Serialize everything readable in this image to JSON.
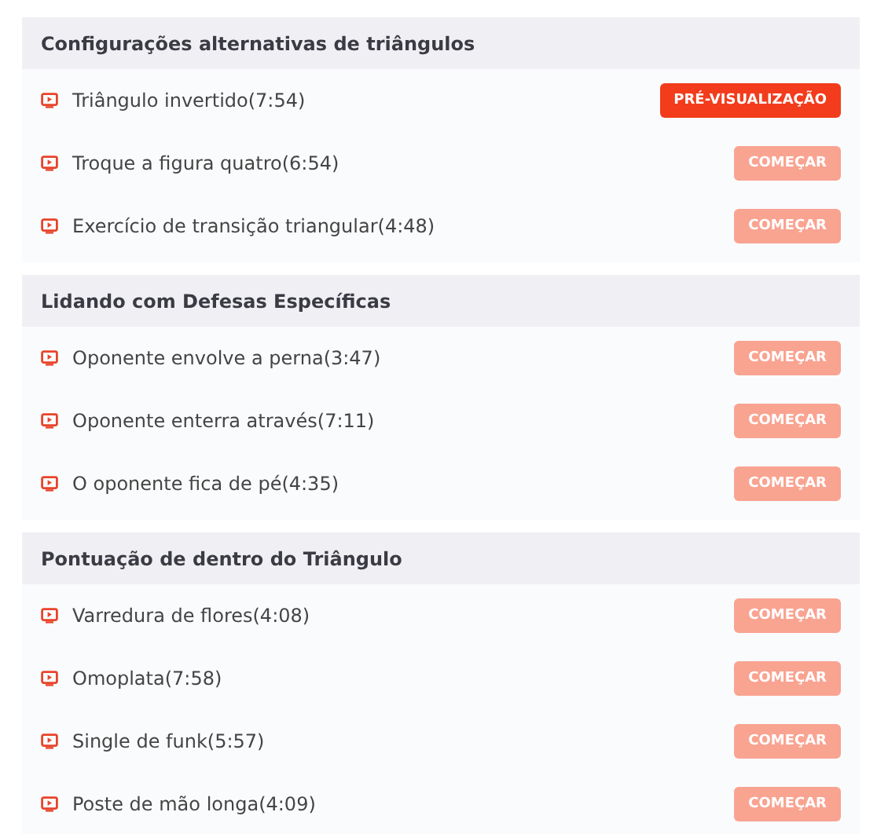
{
  "sections": [
    {
      "title": "Configurações alternativas de triângulos",
      "lessons": [
        {
          "title": "Triângulo invertido(7:54)",
          "button": {
            "label": "PRÉ-VISUALIZAÇÃO",
            "kind": "preview"
          }
        },
        {
          "title": "Troque a figura quatro(6:54)",
          "button": {
            "label": "COMEÇAR",
            "kind": "start"
          }
        },
        {
          "title": "Exercício de transição triangular(4:48)",
          "button": {
            "label": "COMEÇAR",
            "kind": "start"
          }
        }
      ]
    },
    {
      "title": "Lidando com Defesas Específicas",
      "lessons": [
        {
          "title": "Oponente envolve a perna(3:47)",
          "button": {
            "label": "COMEÇAR",
            "kind": "start"
          }
        },
        {
          "title": "Oponente enterra através(7:11)",
          "button": {
            "label": "COMEÇAR",
            "kind": "start"
          }
        },
        {
          "title": "O oponente fica de pé(4:35)",
          "button": {
            "label": "COMEÇAR",
            "kind": "start"
          }
        }
      ]
    },
    {
      "title": "Pontuação de dentro do Triângulo",
      "lessons": [
        {
          "title": "Varredura de flores(4:08)",
          "button": {
            "label": "COMEÇAR",
            "kind": "start"
          }
        },
        {
          "title": "Omoplata(7:58)",
          "button": {
            "label": "COMEÇAR",
            "kind": "start"
          }
        },
        {
          "title": "Single de funk(5:57)",
          "button": {
            "label": "COMEÇAR",
            "kind": "start"
          }
        },
        {
          "title": "Poste de mão longa(4:09)",
          "button": {
            "label": "COMEÇAR",
            "kind": "start"
          }
        }
      ]
    }
  ]
}
